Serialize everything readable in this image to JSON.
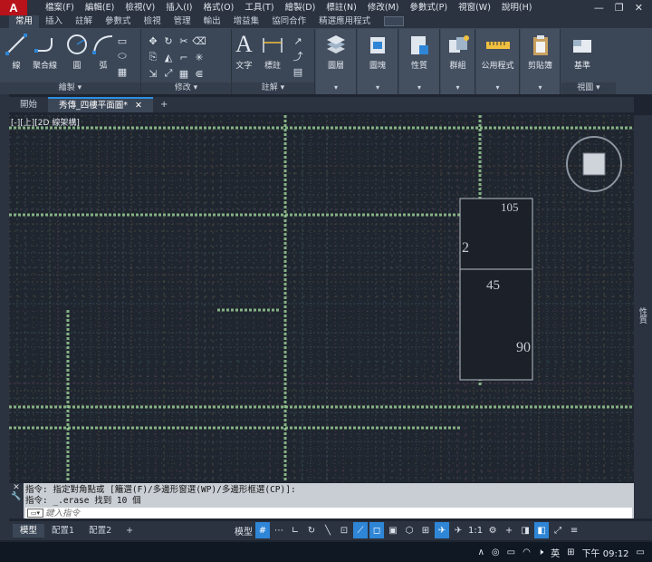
{
  "menubar": {
    "logo": "A",
    "items": [
      "檔案(F)",
      "編輯(E)",
      "檢視(V)",
      "插入(I)",
      "格式(O)",
      "工具(T)",
      "繪製(D)",
      "標註(N)",
      "修改(M)",
      "參數式(P)",
      "視窗(W)",
      "說明(H)"
    ],
    "controls": [
      "—",
      "❐",
      "✕"
    ]
  },
  "ribbon_tabs": [
    "常用",
    "插入",
    "註解",
    "參數式",
    "檢視",
    "管理",
    "輸出",
    "增益集",
    "協同合作",
    "精選應用程式"
  ],
  "ribbon": {
    "draw": {
      "title": "繪製",
      "line": "線",
      "polyline": "聚合線",
      "circle": "圓",
      "arc": "弧"
    },
    "modify": {
      "title": "修改"
    },
    "annotation": {
      "title": "註解",
      "text": "文字",
      "dimension": "標註"
    },
    "layers": "圖層",
    "block": "圖塊",
    "properties": "性質",
    "groups": "群組",
    "utilities": "公用程式",
    "clipboard": "剪貼簿",
    "view": {
      "title": "視圖",
      "base": "基準"
    }
  },
  "file_tabs": {
    "start": "開始",
    "active": "秀傳_四樓平面圖*",
    "close": "✕",
    "add": "+"
  },
  "canvas": {
    "viewport_label": "[-][上][2D 線架構]",
    "annotations": [
      "105",
      "2",
      "45",
      "90"
    ]
  },
  "side_panel": {
    "properties_tab": "性質"
  },
  "command_line": {
    "history": [
      "指令: 指定對角點或 [籬選(F)/多邊形窗選(WP)/多邊形框選(CP)]:",
      "指令: _.erase 找到 10 個"
    ],
    "placeholder": "鍵入指令"
  },
  "layout_tabs": [
    "模型",
    "配置1",
    "配置2",
    "+"
  ],
  "status_bar": {
    "model_label": "模型",
    "scale": "1:1"
  },
  "taskbar": {
    "ime_lang": "英",
    "time": "下午 09:12"
  },
  "colors": {
    "accent": "#2f86d6",
    "ribbon_bg": "#3b4656",
    "canvas_bg": "#20262f",
    "logo_red": "#b8121a"
  }
}
